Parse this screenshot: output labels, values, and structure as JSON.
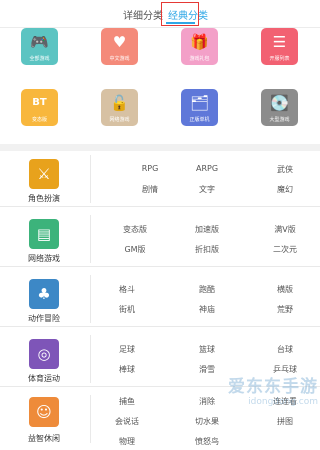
{
  "tabs": [
    {
      "label": "详细分类"
    },
    {
      "label": "经典分类"
    }
  ],
  "grid": [
    {
      "label": "全部游戏",
      "icon": "gamepad-icon",
      "color": "#5cc4c2",
      "glyph": "🎮"
    },
    {
      "label": "中文游戏",
      "icon": "heart-icon",
      "color": "#f48a7a",
      "glyph": "♥"
    },
    {
      "label": "游戏礼包",
      "icon": "gift-icon",
      "color": "#f3a0c8",
      "glyph": "🎁"
    },
    {
      "label": "开服列表",
      "icon": "list-icon",
      "color": "#f26172",
      "glyph": "☰"
    },
    {
      "label": "变态版",
      "icon": "bt-icon",
      "color": "#f8b73d",
      "glyph": "BT"
    },
    {
      "label": "网络游戏",
      "icon": "unlock-icon",
      "color": "#d7c1a3",
      "glyph": "🔓"
    },
    {
      "label": "正版单机",
      "icon": "folder-icon",
      "color": "#5f78d9",
      "glyph": "🗂"
    },
    {
      "label": "大型游戏",
      "icon": "disk-icon",
      "color": "#8c8c8c",
      "glyph": "💽"
    }
  ],
  "categories": [
    {
      "title": "角色扮演",
      "icon": "swords-icon",
      "color": "#e8a21c",
      "glyph": "⚔",
      "items": [
        "RPG",
        "ARPG",
        "武侠",
        "剧情",
        "文字",
        "魔幻"
      ]
    },
    {
      "title": "网络游戏",
      "icon": "browser-icon",
      "color": "#3cb37b",
      "glyph": "▤",
      "items": [
        "变态版",
        "加速版",
        "满V版",
        "GM版",
        "折扣版",
        "二次元"
      ]
    },
    {
      "title": "动作冒险",
      "icon": "mushroom-icon",
      "color": "#3d88c6",
      "glyph": "♣",
      "items": [
        "格斗",
        "跑酷",
        "横版",
        "街机",
        "神庙",
        "荒野"
      ]
    },
    {
      "title": "体育运动",
      "icon": "basketball-icon",
      "color": "#7e55b8",
      "glyph": "◎",
      "items": [
        "足球",
        "篮球",
        "台球",
        "棒球",
        "滑雪",
        "乒乓球"
      ]
    },
    {
      "title": "益智休闲",
      "icon": "cat-face-icon",
      "color": "#ee8b3a",
      "glyph": "☺",
      "items": [
        "捕鱼",
        "消除",
        "连连看",
        "会说话",
        "切水果",
        "拼图",
        "物理",
        "愤怒鸟"
      ]
    }
  ],
  "watermark": {
    "line1": "爱东东手游",
    "line2": "idongdong.com"
  }
}
